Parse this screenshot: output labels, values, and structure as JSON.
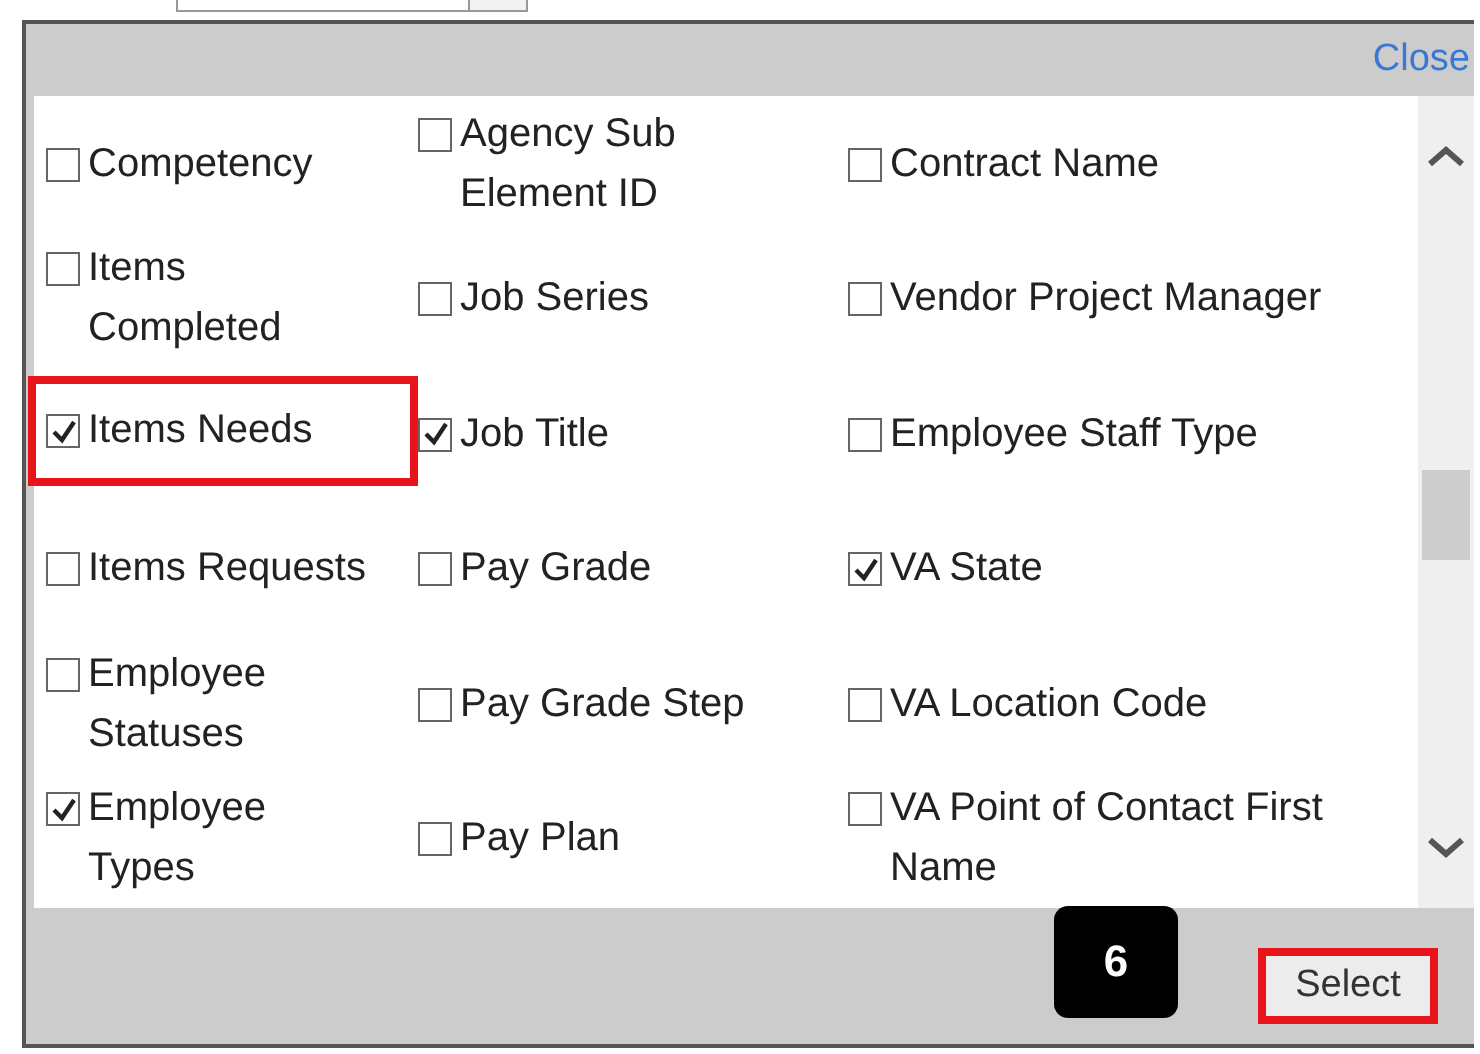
{
  "dialog": {
    "close_label": "Close",
    "options": [
      {
        "label": "Competency",
        "checked": false,
        "highlighted": false
      },
      {
        "label": "Agency Sub Element ID",
        "checked": false,
        "highlighted": false
      },
      {
        "label": "Contract Name",
        "checked": false,
        "highlighted": false
      },
      {
        "label": "Items Completed",
        "checked": false,
        "highlighted": false
      },
      {
        "label": "Job Series",
        "checked": false,
        "highlighted": false
      },
      {
        "label": "Vendor Project Manager",
        "checked": false,
        "highlighted": false
      },
      {
        "label": "Items Needs",
        "checked": true,
        "highlighted": true
      },
      {
        "label": "Job Title",
        "checked": true,
        "highlighted": false
      },
      {
        "label": "Employee Staff Type",
        "checked": false,
        "highlighted": false
      },
      {
        "label": "Items Requests",
        "checked": false,
        "highlighted": false
      },
      {
        "label": "Pay Grade",
        "checked": false,
        "highlighted": false
      },
      {
        "label": "VA State",
        "checked": true,
        "highlighted": false
      },
      {
        "label": "Employee Statuses",
        "checked": false,
        "highlighted": false
      },
      {
        "label": "Pay Grade Step",
        "checked": false,
        "highlighted": false
      },
      {
        "label": "VA Location Code",
        "checked": false,
        "highlighted": false
      },
      {
        "label": "Employee Types",
        "checked": true,
        "highlighted": false
      },
      {
        "label": "Pay Plan",
        "checked": false,
        "highlighted": false
      },
      {
        "label": "VA Point of Contact First Name",
        "checked": false,
        "highlighted": false
      }
    ],
    "step_badge": "6",
    "select_button": {
      "label": "Select",
      "highlighted": true
    }
  }
}
